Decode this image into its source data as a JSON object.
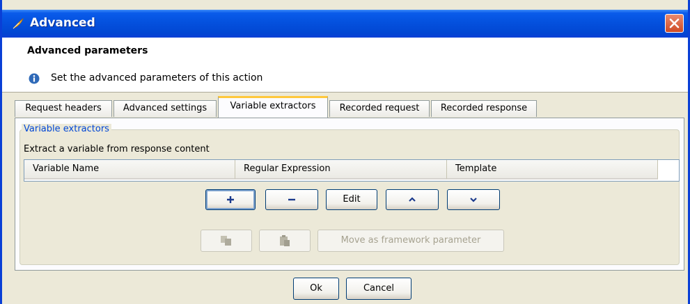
{
  "window": {
    "title": "Advanced",
    "app_icon": "feather-icon",
    "close_icon": "close-icon",
    "colors": {
      "titlebar": "#0451de",
      "close_button": "#d04a24",
      "tab_highlight": "#ffc83c",
      "group_legend": "#0046d5"
    }
  },
  "header": {
    "title": "Advanced parameters",
    "description": "Set the advanced parameters of this action",
    "icon": "info-icon"
  },
  "tabs": [
    {
      "label": "Request headers",
      "active": false
    },
    {
      "label": "Advanced settings",
      "active": false
    },
    {
      "label": "Variable extractors",
      "active": true
    },
    {
      "label": "Recorded request",
      "active": false
    },
    {
      "label": "Recorded response",
      "active": false
    }
  ],
  "panel": {
    "group_title": "Variable extractors",
    "extract_label": "Extract a variable from response content",
    "table": {
      "columns": [
        "Variable Name",
        "Regular Expression",
        "Template"
      ],
      "rows": []
    },
    "toolbar": {
      "add_icon": "plus-icon",
      "remove_icon": "minus-icon",
      "edit_label": "Edit",
      "up_icon": "chevron-up-icon",
      "down_icon": "chevron-down-icon"
    },
    "secondary": {
      "copy_icon": "copy-icon",
      "paste_icon": "paste-icon",
      "move_label": "Move as framework parameter"
    }
  },
  "footer": {
    "ok_label": "Ok",
    "cancel_label": "Cancel"
  }
}
